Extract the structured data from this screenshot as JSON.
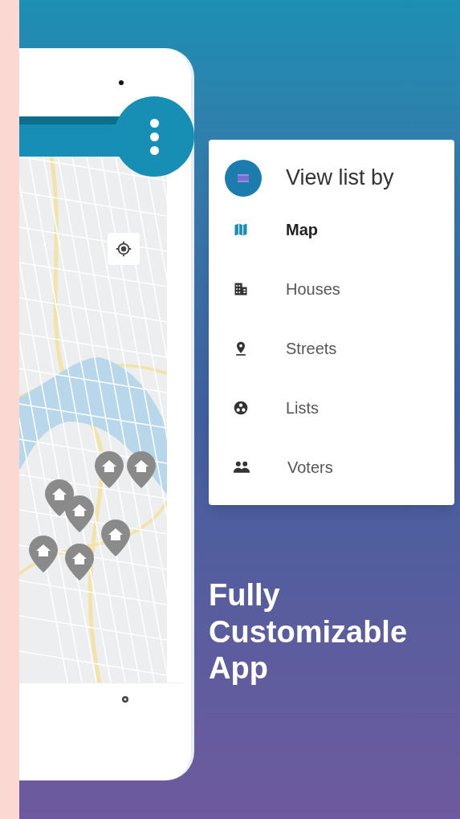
{
  "menu": {
    "title": "View list by",
    "items": [
      {
        "label": "Map",
        "selected": true
      },
      {
        "label": "Houses",
        "selected": false
      },
      {
        "label": "Streets",
        "selected": false
      },
      {
        "label": "Lists",
        "selected": false
      },
      {
        "label": "Voters",
        "selected": false
      }
    ]
  },
  "headline": [
    "Fully",
    "Customizable",
    "App"
  ]
}
